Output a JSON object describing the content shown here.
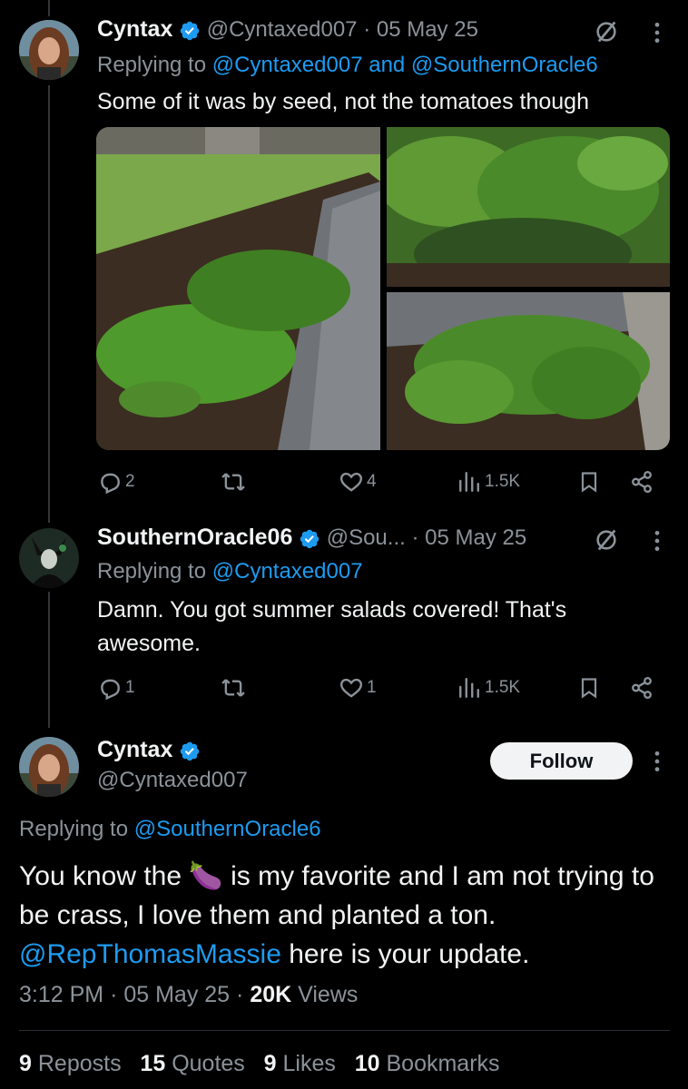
{
  "reply1": {
    "name": "Cyntax",
    "handle": "@Cyntaxed007",
    "dot_date": "· 05 May 25",
    "replying_prefix": "Replying to",
    "replying_targets": "@Cyntaxed007 and @SouthernOracle6",
    "text": "Some of it was by seed, not the tomatoes though",
    "replies": "2",
    "reposts": "",
    "likes": "4",
    "views": "1.5K"
  },
  "reply2": {
    "name": "SouthernOracle06",
    "handle": "@Sou...",
    "dot_date": "· 05 May 25",
    "replying_prefix": "Replying to",
    "replying_targets": "@Cyntaxed007",
    "text": "Damn. You got summer salads covered! That's awesome.",
    "replies": "1",
    "reposts": "",
    "likes": "1",
    "views": "1.5K"
  },
  "main": {
    "name": "Cyntax",
    "handle": "@Cyntaxed007",
    "follow_label": "Follow",
    "replying_prefix": "Replying to",
    "replying_target": "@SouthernOracle6",
    "text_before_emoji": "You know the",
    "emoji": "🍆",
    "text_after_emoji": "is my favorite and I am not trying to be crass, I love them and planted a ton.",
    "mention": "@RepThomasMassie",
    "text_end": "here is your update.",
    "time": "3:12 PM",
    "date": "05 May 25",
    "views_count": "20K",
    "views_label": "Views",
    "reposts_count": "9",
    "reposts_label": "Reposts",
    "quotes_count": "15",
    "quotes_label": "Quotes",
    "likes_count": "9",
    "likes_label": "Likes",
    "bookmarks_count": "10",
    "bookmarks_label": "Bookmarks"
  },
  "colors": {
    "background": "#000000",
    "link": "#1d9bf0",
    "verified": "#1d9bf0",
    "muted": "#8b9299",
    "text": "#f2f3f4"
  },
  "icons": [
    "verified-badge-icon",
    "grok-icon",
    "more-icon",
    "reply-icon",
    "repost-icon",
    "like-icon",
    "views-icon",
    "bookmark-icon",
    "share-icon"
  ]
}
